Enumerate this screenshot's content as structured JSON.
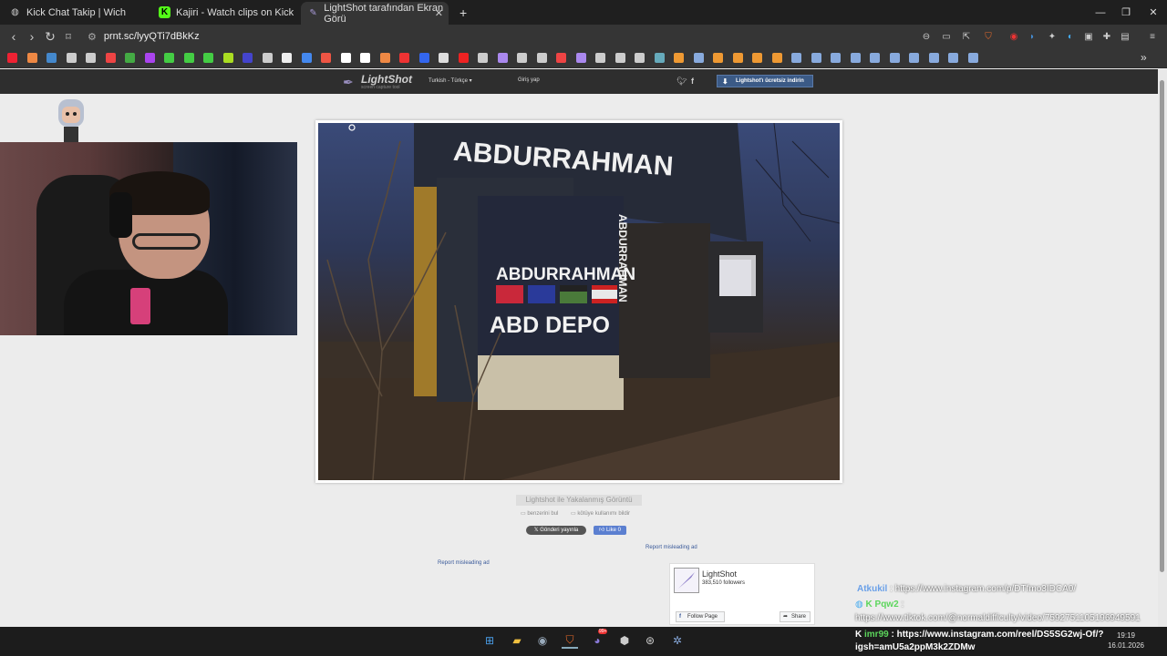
{
  "browser": {
    "tabs": [
      {
        "label": "Kick Chat Takip | Wich",
        "icon": "globe-icon"
      },
      {
        "label": "Kajiri - Watch clips on Kick",
        "icon": "kick-icon"
      },
      {
        "label": "LightShot tarafından Ekran Görü",
        "icon": "lightshot-icon",
        "active": true
      }
    ],
    "new_tab": "+",
    "url": "prnt.sc/lyyQTi7dBkKz",
    "window_controls": {
      "minimize": "—",
      "maximize": "❐",
      "close": "✕"
    },
    "colors": {
      "tabbar": "#1f1f1f",
      "toolbar": "#353535"
    }
  },
  "bookmarks": {
    "colors": [
      "#e23",
      "#e84",
      "#48c",
      "#ccc",
      "#ccc",
      "#e44",
      "#4a4",
      "#a4e",
      "#4c4",
      "#4c4",
      "#4c4",
      "#ad2",
      "#44c",
      "#ccc",
      "#eee",
      "#48e",
      "#e54",
      "#fff",
      "#fff",
      "#e84",
      "#e33",
      "#36e",
      "#ddd",
      "#e22",
      "#ccc",
      "#a8e",
      "#ccc",
      "#ccc",
      "#e44",
      "#a8e",
      "#ccc",
      "#ccc",
      "#ccc",
      "#6ab",
      "#e93",
      "#8ad",
      "#e93",
      "#e93",
      "#e93",
      "#e93",
      "#8ad",
      "#8ad",
      "#8ad",
      "#8ad",
      "#8ad",
      "#8ad",
      "#8ad",
      "#8ad",
      "#8ad",
      "#8ad"
    ],
    "overflow": "»"
  },
  "lightshot": {
    "logo": "LightShot",
    "tagline": "screen capture tool",
    "language": "Turkish - Türkçe",
    "login": "Giriş yap",
    "download": "Lightshot'ı ücretsiz indirin",
    "caption": "Lightshot ile Yakalanmış Görüntü",
    "find_similar": "benzerini bul",
    "report_abuse": "kötüye kullanımı bildir",
    "tweet": "Gönderi yayınla",
    "like": "Like 0",
    "report_ad_1": "Report misleading ad",
    "report_ad_2": "Report misleading ad",
    "fb": {
      "name": "LightShot",
      "followers": "383,510 followers",
      "follow": "Follow Page",
      "share": "Share"
    }
  },
  "photo": {
    "sign_top": "ABDURRAHMAN",
    "sign_mid": "ABDURRAHMAN",
    "sign_depo": "ABD DEPO",
    "sign_vertical": "ABDURRAHMAN"
  },
  "chat": [
    {
      "user": "Atkukil",
      "text": ": https://www.instagram.com/p/DTfmo3IDCA0/",
      "color": "#6aa0e8"
    },
    {
      "user": "Pqw2",
      "text": ":",
      "color": "#5cd65c"
    },
    {
      "user": "",
      "text": "https://www.tiktok.com/@normaldifficulty/video/7592751105196949591",
      "color": "#ffffff"
    },
    {
      "user": "imr99",
      "text": ": https://www.instagram.com/reel/DS5SG2wj-Of/?",
      "color": "#5cd65c"
    },
    {
      "user": "",
      "text": "igsh=amU5a2ppM3k2ZDMw",
      "color": "#ffffff"
    }
  ],
  "taskbar": {
    "clock": "19:19",
    "date": "16.01.2026",
    "badge": "99+"
  }
}
